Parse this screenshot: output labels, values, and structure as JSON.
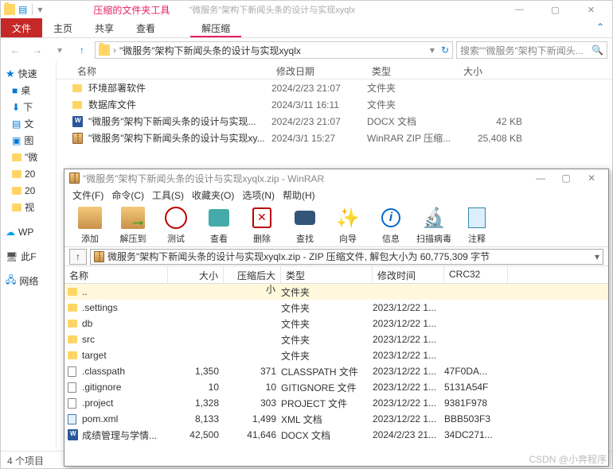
{
  "explorer": {
    "title_tools": "压缩的文件夹工具",
    "title_path": "\"微服务\"架构下新闻头条的设计与实现xyqlx",
    "ribbon": {
      "file": "文件",
      "home": "主页",
      "share": "共享",
      "view": "查看",
      "extract": "解压缩"
    },
    "breadcrumb": "\"微服务\"架构下新闻头条的设计与实现xyqlx",
    "search_placeholder": "搜索\"\"微服务\"架构下新闻头...",
    "sidebar": {
      "quick": "快速",
      "items": [
        "桌",
        "下",
        "文",
        "图",
        "\"微",
        "20",
        "20",
        "视"
      ],
      "wp": "WP",
      "pc": "此F",
      "net": "网络"
    },
    "cols": {
      "name": "名称",
      "date": "修改日期",
      "type": "类型",
      "size": "大小"
    },
    "files": [
      {
        "icon": "folder",
        "name": "环境部署软件",
        "date": "2024/2/23 21:07",
        "type": "文件夹",
        "size": ""
      },
      {
        "icon": "folder",
        "name": "数据库文件",
        "date": "2024/3/11 16:11",
        "type": "文件夹",
        "size": ""
      },
      {
        "icon": "docx",
        "name": "\"微服务\"架构下新闻头条的设计与实现...",
        "date": "2024/2/23 21:07",
        "type": "DOCX 文档",
        "size": "42 KB"
      },
      {
        "icon": "zip",
        "name": "\"微服务\"架构下新闻头条的设计与实现xy...",
        "date": "2024/3/1 15:27",
        "type": "WinRAR ZIP 压缩...",
        "size": "25,408 KB"
      }
    ],
    "status": "4 个项目"
  },
  "winrar": {
    "title": "\"微服务\"架构下新闻头条的设计与实现xyqlx.zip - WinRAR",
    "menu": {
      "file": "文件(F)",
      "cmd": "命令(C)",
      "tool": "工具(S)",
      "fav": "收藏夹(O)",
      "opt": "选项(N)",
      "help": "帮助(H)"
    },
    "tools": {
      "add": "添加",
      "extract": "解压到",
      "test": "测试",
      "view": "查看",
      "delete": "删除",
      "find": "查找",
      "wizard": "向导",
      "info": "信息",
      "virus": "扫描病毒",
      "comment": "注释"
    },
    "path": "微服务\"架构下新闻头条的设计与实现xyqlx.zip - ZIP 压缩文件, 解包大小为 60,775,309 字节",
    "cols": {
      "name": "名称",
      "size": "大小",
      "packed": "压缩后大小",
      "type": "类型",
      "mtime": "修改时间",
      "crc": "CRC32"
    },
    "rows": [
      {
        "icon": "up",
        "name": "..",
        "size": "",
        "packed": "",
        "type": "文件夹",
        "mtime": "",
        "crc": ""
      },
      {
        "icon": "fd",
        "name": ".settings",
        "size": "",
        "packed": "",
        "type": "文件夹",
        "mtime": "2023/12/22 1...",
        "crc": ""
      },
      {
        "icon": "fd",
        "name": "db",
        "size": "",
        "packed": "",
        "type": "文件夹",
        "mtime": "2023/12/22 1...",
        "crc": ""
      },
      {
        "icon": "fd",
        "name": "src",
        "size": "",
        "packed": "",
        "type": "文件夹",
        "mtime": "2023/12/22 1...",
        "crc": ""
      },
      {
        "icon": "fd",
        "name": "target",
        "size": "",
        "packed": "",
        "type": "文件夹",
        "mtime": "2023/12/22 1...",
        "crc": ""
      },
      {
        "icon": "fl",
        "name": ".classpath",
        "size": "1,350",
        "packed": "371",
        "type": "CLASSPATH 文件",
        "mtime": "2023/12/22 1...",
        "crc": "47F0DA..."
      },
      {
        "icon": "fl",
        "name": ".gitignore",
        "size": "10",
        "packed": "10",
        "type": "GITIGNORE 文件",
        "mtime": "2023/12/22 1...",
        "crc": "5131A54F"
      },
      {
        "icon": "fl",
        "name": ".project",
        "size": "1,328",
        "packed": "303",
        "type": "PROJECT 文件",
        "mtime": "2023/12/22 1...",
        "crc": "9381F978"
      },
      {
        "icon": "xml",
        "name": "pom.xml",
        "size": "8,133",
        "packed": "1,499",
        "type": "XML 文档",
        "mtime": "2023/12/22 1...",
        "crc": "BBB503F3"
      },
      {
        "icon": "dx",
        "name": "成绩管理与学情...",
        "size": "42,500",
        "packed": "41,646",
        "type": "DOCX 文档",
        "mtime": "2024/2/23 21...",
        "crc": "34DC271..."
      }
    ]
  },
  "watermark": "CSDN @小奔程序"
}
